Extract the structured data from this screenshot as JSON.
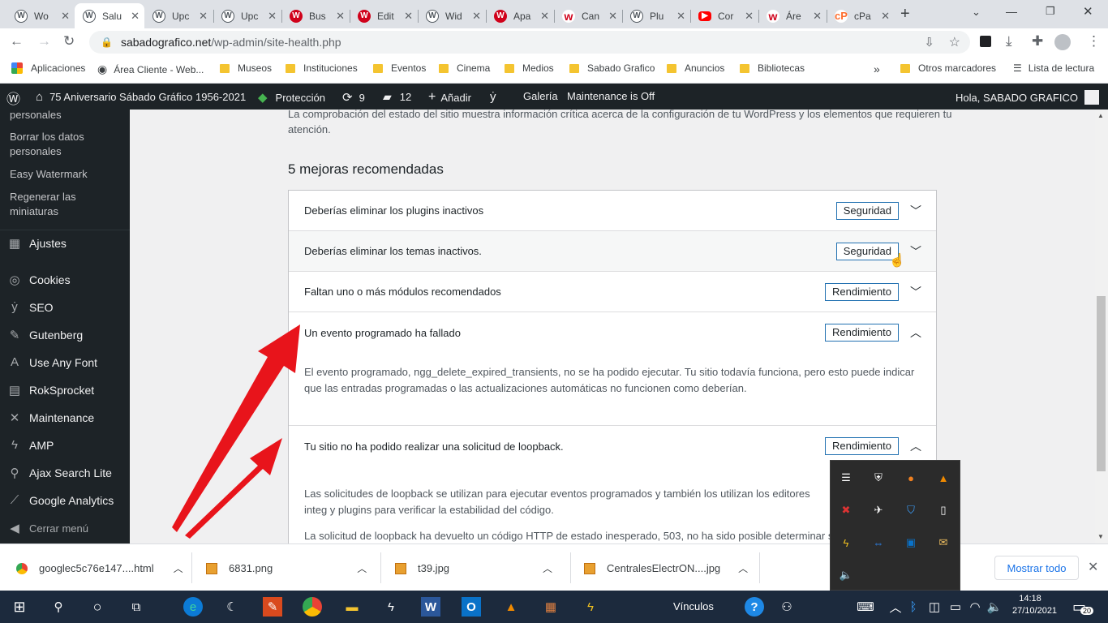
{
  "browser": {
    "tabs": [
      {
        "label": "Wo",
        "icon": "wordpress-icon"
      },
      {
        "label": "Salu",
        "icon": "wordpress-icon"
      },
      {
        "label": "Upc",
        "icon": "wordpress-icon"
      },
      {
        "label": "Upc",
        "icon": "wordpress-icon"
      },
      {
        "label": "Bus",
        "icon": "wix-icon"
      },
      {
        "label": "Edit",
        "icon": "wix-icon"
      },
      {
        "label": "Wid",
        "icon": "wordpress-icon"
      },
      {
        "label": "Apa",
        "icon": "wix-icon"
      },
      {
        "label": "Can",
        "icon": "wix-logo-icon"
      },
      {
        "label": "Plu",
        "icon": "wordpress-icon"
      },
      {
        "label": "Cor",
        "icon": "youtube-icon"
      },
      {
        "label": "Áre",
        "icon": "wix-logo-icon"
      },
      {
        "label": "cPa",
        "icon": "cpanel-icon"
      }
    ],
    "new_tab": "+",
    "url_host": "sabadografico.net",
    "url_path": "/wp-admin/site-health.php",
    "bookmarks": [
      {
        "label": "Aplicaciones"
      },
      {
        "label": "Área Cliente - Web..."
      },
      {
        "label": "Museos"
      },
      {
        "label": "Instituciones"
      },
      {
        "label": "Eventos"
      },
      {
        "label": "Cinema"
      },
      {
        "label": "Medios"
      },
      {
        "label": "Sabado Grafico"
      },
      {
        "label": "Anuncios"
      },
      {
        "label": "Bibliotecas"
      }
    ],
    "bookmarks_more": "»",
    "other_bookmarks": "Otros marcadores",
    "reading_list": "Lista de lectura"
  },
  "adminbar": {
    "site_name": "75 Aniversario Sábado Gráfico 1956-2021",
    "protection": "Protección",
    "updates_count": "9",
    "comments_count": "12",
    "add_new": "Añadir",
    "gallery": "Galería",
    "maintenance": "Maintenance is Off",
    "greeting": "Hola, SABADO GRAFICO"
  },
  "sidebar": {
    "submenu": [
      {
        "label": "personales"
      },
      {
        "label": "Borrar los datos personales"
      },
      {
        "label": "Easy Watermark"
      },
      {
        "label": "Regenerar las miniaturas"
      }
    ],
    "items": [
      {
        "label": "Ajustes",
        "icon": "sliders-icon"
      },
      {
        "label": "Cookies",
        "icon": "cookie-icon"
      },
      {
        "label": "SEO",
        "icon": "yoast-icon"
      },
      {
        "label": "Gutenberg",
        "icon": "pencil-icon"
      },
      {
        "label": "Use Any Font",
        "icon": "font-icon"
      },
      {
        "label": "RokSprocket",
        "icon": "rocket-icon"
      },
      {
        "label": "Maintenance",
        "icon": "tools-icon"
      },
      {
        "label": "AMP",
        "icon": "amp-icon"
      },
      {
        "label": "Ajax Search Lite",
        "icon": "search-icon"
      },
      {
        "label": "Google Analytics",
        "icon": "chart-icon"
      },
      {
        "label": "Cerrar menú",
        "icon": "collapse-icon"
      }
    ]
  },
  "main": {
    "intro": "La comprobación del estado del sitio muestra información crítica acerca de la configuración de tu WordPress y los elementos que requieren tu atención.",
    "recommended_heading": "5 mejoras recomendadas",
    "issues": [
      {
        "title": "Deberías eliminar los plugins inactivos",
        "badge": "Seguridad",
        "expanded": false
      },
      {
        "title": "Deberías eliminar los temas inactivos.",
        "badge": "Seguridad",
        "expanded": false
      },
      {
        "title": "Faltan uno o más módulos recomendados",
        "badge": "Rendimiento",
        "expanded": false
      },
      {
        "title": "Un evento programado ha fallado",
        "badge": "Rendimiento",
        "expanded": true,
        "description": "El evento programado, ngg_delete_expired_transients, no se ha podido ejecutar. Tu sitio todavía funciona, pero esto puede indicar que las entradas programadas o las actualizaciones automáticas no funcionen como deberían."
      },
      {
        "title": "Tu sitio no ha podido realizar una solicitud de loopback.",
        "badge": "Rendimiento",
        "expanded": true,
        "description": "Las solicitudes de loopback se utilizan para ejecutar eventos programados y también los utilizan los editores integ y plugins para verificar la estabilidad del código.",
        "description2": "La solicitud de loopback ha devuelto un código HTTP de estado inesperado, 503, no ha sido posible determinar s"
      }
    ]
  },
  "downloads": {
    "items": [
      {
        "name": "googlec5c76e147....html"
      },
      {
        "name": "6831.png"
      },
      {
        "name": "t39.jpg"
      },
      {
        "name": "CentralesElectrON....jpg"
      }
    ],
    "show_all": "Mostrar todo"
  },
  "taskbar": {
    "links_label": "Vínculos",
    "time": "14:18",
    "date": "27/10/2021",
    "notifications": "20"
  },
  "colors": {
    "adminbar": "#1d2327",
    "badge_border": "#2271b1",
    "arrow": "#e8141b",
    "taskbar": "#1c2a3d"
  }
}
